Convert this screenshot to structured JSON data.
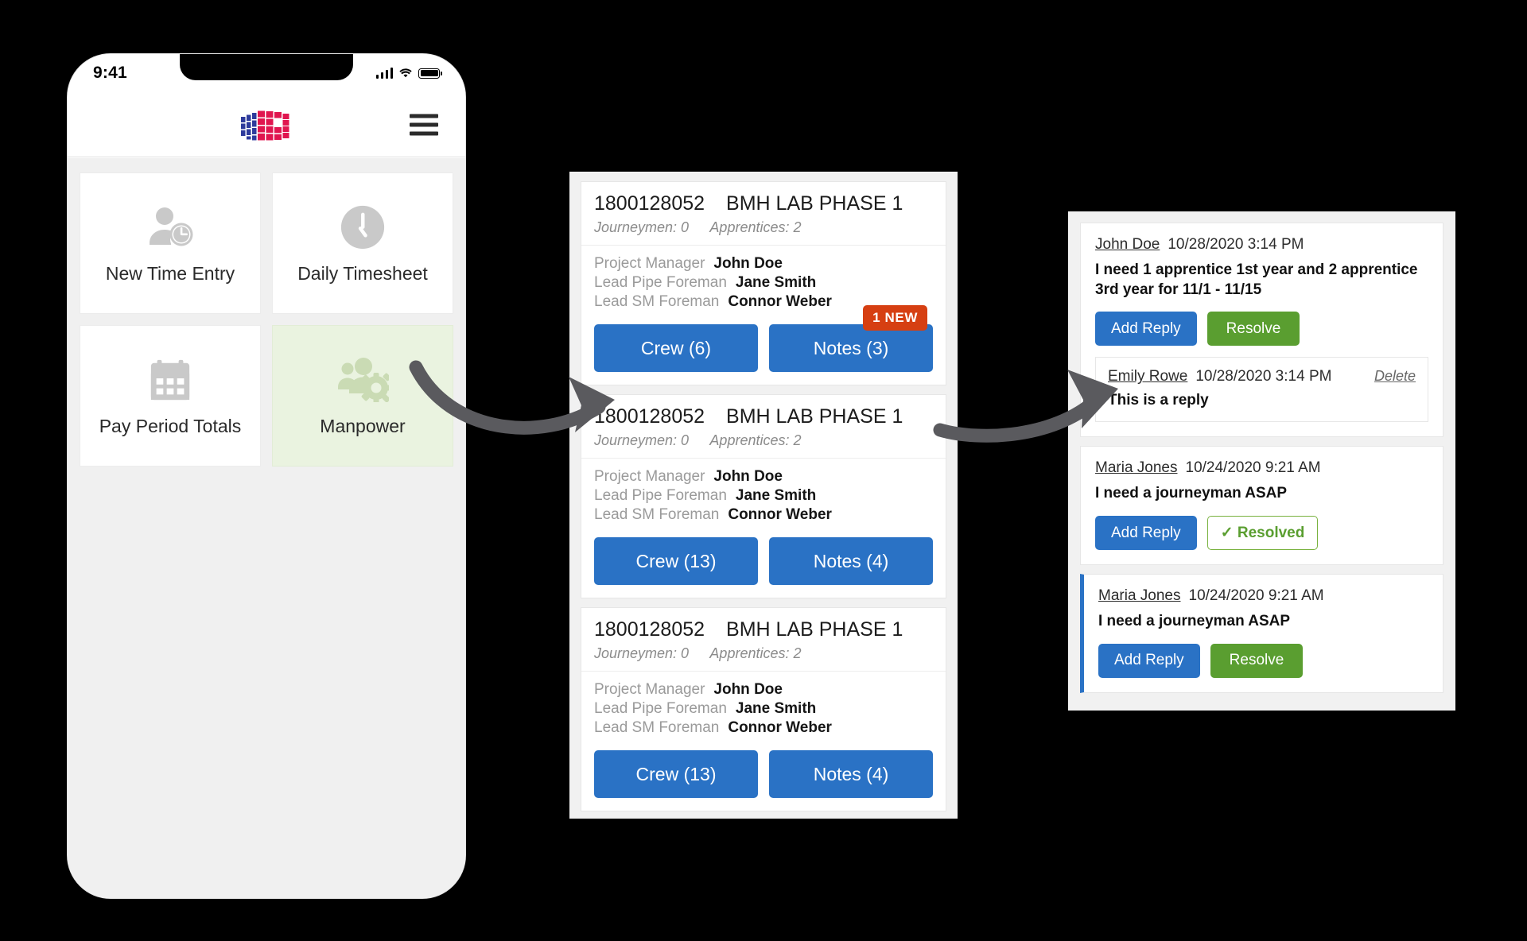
{
  "phone": {
    "status": {
      "time": "9:41",
      "signal_icon": "signal-bars-icon",
      "wifi_icon": "wifi-icon",
      "battery_icon": "battery-icon"
    },
    "appbar": {
      "logo_icon": "company-building-logo",
      "menu_icon": "hamburger-menu-icon"
    },
    "tiles": [
      {
        "label": "New Time Entry",
        "icon": "person-clock-icon",
        "active": false
      },
      {
        "label": "Daily Timesheet",
        "icon": "clock-icon",
        "active": false
      },
      {
        "label": "Pay Period Totals",
        "icon": "calendar-icon",
        "active": false
      },
      {
        "label": "Manpower",
        "icon": "people-gear-icon",
        "active": true
      }
    ]
  },
  "projects": [
    {
      "number": "1800128052",
      "name": "BMH LAB PHASE 1",
      "journeymen_label": "Journeymen: 0",
      "apprentices_label": "Apprentices: 2",
      "roles": [
        {
          "label": "Project Manager",
          "value": "John Doe"
        },
        {
          "label": "Lead Pipe Foreman",
          "value": "Jane Smith"
        },
        {
          "label": "Lead SM Foreman",
          "value": "Connor Weber"
        }
      ],
      "crew_label": "Crew (6)",
      "notes_label": "Notes (3)",
      "badge": "1 NEW"
    },
    {
      "number": "1800128052",
      "name": "BMH LAB PHASE 1",
      "journeymen_label": "Journeymen: 0",
      "apprentices_label": "Apprentices: 2",
      "roles": [
        {
          "label": "Project Manager",
          "value": "John Doe"
        },
        {
          "label": "Lead Pipe Foreman",
          "value": "Jane Smith"
        },
        {
          "label": "Lead SM Foreman",
          "value": "Connor Weber"
        }
      ],
      "crew_label": "Crew (13)",
      "notes_label": "Notes (4)",
      "badge": ""
    },
    {
      "number": "1800128052",
      "name": "BMH LAB PHASE 1",
      "journeymen_label": "Journeymen: 0",
      "apprentices_label": "Apprentices: 2",
      "roles": [
        {
          "label": "Project Manager",
          "value": "John Doe"
        },
        {
          "label": "Lead Pipe Foreman",
          "value": "Jane Smith"
        },
        {
          "label": "Lead SM Foreman",
          "value": "Connor Weber"
        }
      ],
      "crew_label": "Crew (13)",
      "notes_label": "Notes (4)",
      "badge": ""
    }
  ],
  "notes": [
    {
      "author": "John Doe",
      "date": "10/28/2020 3:14 PM",
      "text": "I need 1 apprentice 1st year and 2 apprentice 3rd year for 11/1 - 11/15",
      "reply_label": "Add Reply",
      "resolve_label": "Resolve",
      "resolve_state": "unresolved",
      "accent": false,
      "reply": {
        "author": "Emily Rowe",
        "date": "10/28/2020 3:14 PM",
        "delete_label": "Delete",
        "text": "This is a reply"
      }
    },
    {
      "author": "Maria Jones",
      "date": "10/24/2020 9:21 AM",
      "text": "I need a journeyman ASAP",
      "reply_label": "Add Reply",
      "resolve_label": "✓ Resolved",
      "resolve_state": "resolved",
      "accent": false,
      "reply": null
    },
    {
      "author": "Maria Jones",
      "date": "10/24/2020 9:21 AM",
      "text": "I need a journeyman ASAP",
      "reply_label": "Add Reply",
      "resolve_label": "Resolve",
      "resolve_state": "unresolved",
      "accent": true,
      "reply": null
    }
  ],
  "colors": {
    "primary_blue": "#2a72c5",
    "resolve_green": "#5a9e30",
    "badge_red": "#d63f12",
    "tile_active_bg": "#eaf3e0",
    "arrow_gray": "#5a5a5e"
  },
  "flow": {
    "arrow1_icon": "curved-arrow-right-icon",
    "arrow2_icon": "curved-arrow-right-icon"
  }
}
